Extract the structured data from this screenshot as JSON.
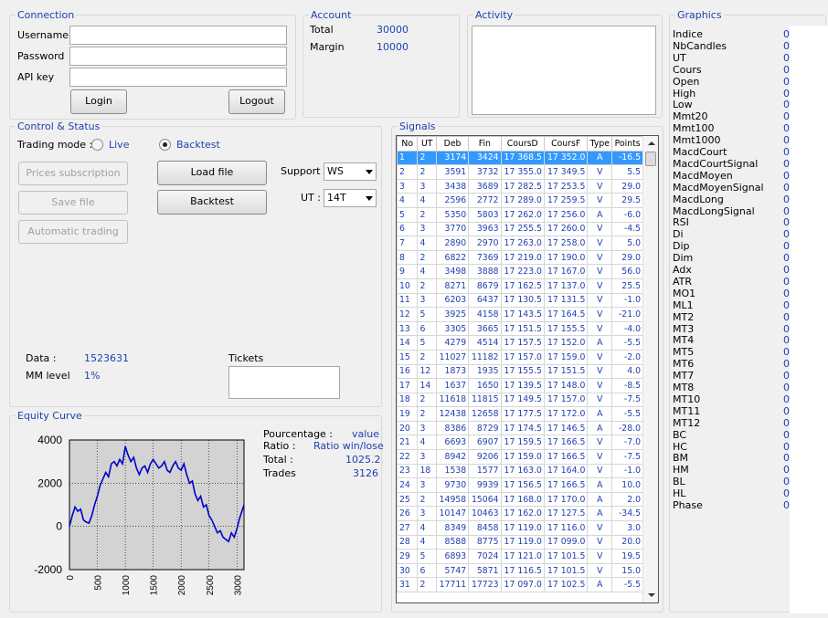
{
  "connection": {
    "title": "Connection",
    "username_label": "Username",
    "password_label": "Password",
    "apikey_label": "API key",
    "login_label": "Login",
    "logout_label": "Logout"
  },
  "account": {
    "title": "Account",
    "total_label": "Total",
    "total_value": "30000",
    "margin_label": "Margin",
    "margin_value": "10000"
  },
  "activity": {
    "title": "Activity"
  },
  "graphics": {
    "title": "Graphics",
    "items": [
      "Indice",
      "NbCandles",
      "UT",
      "Cours",
      "Open",
      "High",
      "Low",
      "Mmt20",
      "Mmt100",
      "Mmt1000",
      "MacdCourt",
      "MacdCourtSignal",
      "MacdMoyen",
      "MacdMoyenSignal",
      "MacdLong",
      "MacdLongSignal",
      "RSI",
      "Di",
      "Dip",
      "Dim",
      "Adx",
      "ATR",
      "MO1",
      "ML1",
      "MT2",
      "MT3",
      "MT4",
      "MT5",
      "MT6",
      "MT7",
      "MT8",
      "MT10",
      "MT11",
      "MT12",
      "BC",
      "HC",
      "BM",
      "HM",
      "BL",
      "HL",
      "Phase"
    ],
    "value": "0"
  },
  "control": {
    "title": "Control & Status",
    "trading_mode_label": "Trading mode :",
    "live_label": "Live",
    "backtest_label": "Backtest",
    "prices_button": "Prices subscription",
    "save_button": "Save file",
    "auto_button": "Automatic trading",
    "load_button": "Load file",
    "backtest_button": "Backtest",
    "support_label": "Support :",
    "support_value": "WS",
    "ut_label": "UT :",
    "ut_value": "14T",
    "data_label": "Data :",
    "data_value": "1523631",
    "mm_label": "MM level",
    "mm_value": "1%",
    "tickets_label": "Tickets"
  },
  "equity": {
    "title": "Equity Curve",
    "pourcentage_label": "Pourcentage :",
    "pourcentage_value": "value",
    "ratio_label": "Ratio :",
    "ratio_value": "Ratio win/lose",
    "total_label": "Total :",
    "total_value": "1025.2",
    "trades_label": "Trades",
    "trades_value": "3126"
  },
  "chart_data": {
    "type": "line",
    "ylim": [
      -2000,
      4000
    ],
    "xlim": [
      0,
      3126
    ],
    "y_ticks": [
      "4000",
      "2000",
      "0",
      "-2000"
    ],
    "x_ticks": [
      "0",
      "500",
      "1000",
      "1500",
      "2000",
      "2500",
      "3000"
    ],
    "grid": true,
    "color": "#0000cc",
    "x": [
      0,
      50,
      100,
      150,
      200,
      250,
      300,
      350,
      400,
      450,
      500,
      550,
      600,
      650,
      700,
      750,
      800,
      850,
      900,
      950,
      1000,
      1050,
      1100,
      1150,
      1200,
      1250,
      1300,
      1350,
      1400,
      1450,
      1500,
      1550,
      1600,
      1650,
      1700,
      1750,
      1800,
      1850,
      1900,
      1950,
      2000,
      2050,
      2100,
      2150,
      2200,
      2250,
      2300,
      2350,
      2400,
      2450,
      2500,
      2550,
      2600,
      2650,
      2700,
      2750,
      2800,
      2850,
      2900,
      2950,
      3000,
      3050,
      3100,
      3126
    ],
    "y": [
      0,
      500,
      900,
      700,
      800,
      300,
      200,
      150,
      500,
      1000,
      1400,
      1900,
      2200,
      2500,
      2300,
      2900,
      3000,
      2800,
      3100,
      2900,
      3700,
      3300,
      3000,
      3200,
      2700,
      2400,
      2700,
      2800,
      2500,
      2900,
      3100,
      2900,
      2700,
      2800,
      3000,
      2600,
      2500,
      2800,
      3000,
      2700,
      2600,
      2900,
      2400,
      2000,
      2100,
      1500,
      1200,
      1400,
      900,
      1000,
      500,
      300,
      0,
      -300,
      -200,
      -500,
      -600,
      -700,
      -300,
      -500,
      -100,
      400,
      800,
      1000
    ]
  },
  "signals": {
    "title": "Signals",
    "columns": [
      "No",
      "UT",
      "Deb",
      "Fin",
      "CoursD",
      "CoursF",
      "Type",
      "Points"
    ],
    "rows": [
      [
        "1",
        "2",
        "3174",
        "3424",
        "17 368.5",
        "17 352.0",
        "A",
        "-16.5"
      ],
      [
        "2",
        "2",
        "3591",
        "3732",
        "17 355.0",
        "17 349.5",
        "V",
        "5.5"
      ],
      [
        "3",
        "3",
        "3438",
        "3689",
        "17 282.5",
        "17 253.5",
        "V",
        "29.0"
      ],
      [
        "4",
        "4",
        "2596",
        "2772",
        "17 289.0",
        "17 259.5",
        "V",
        "29.5"
      ],
      [
        "5",
        "2",
        "5350",
        "5803",
        "17 262.0",
        "17 256.0",
        "A",
        "-6.0"
      ],
      [
        "6",
        "3",
        "3770",
        "3963",
        "17 255.5",
        "17 260.0",
        "V",
        "-4.5"
      ],
      [
        "7",
        "4",
        "2890",
        "2970",
        "17 263.0",
        "17 258.0",
        "V",
        "5.0"
      ],
      [
        "8",
        "2",
        "6822",
        "7369",
        "17 219.0",
        "17 190.0",
        "V",
        "29.0"
      ],
      [
        "9",
        "4",
        "3498",
        "3888",
        "17 223.0",
        "17 167.0",
        "V",
        "56.0"
      ],
      [
        "10",
        "2",
        "8271",
        "8679",
        "17 162.5",
        "17 137.0",
        "V",
        "25.5"
      ],
      [
        "11",
        "3",
        "6203",
        "6437",
        "17 130.5",
        "17 131.5",
        "V",
        "-1.0"
      ],
      [
        "12",
        "5",
        "3925",
        "4158",
        "17 143.5",
        "17 164.5",
        "V",
        "-21.0"
      ],
      [
        "13",
        "6",
        "3305",
        "3665",
        "17 151.5",
        "17 155.5",
        "V",
        "-4.0"
      ],
      [
        "14",
        "5",
        "4279",
        "4514",
        "17 157.5",
        "17 152.0",
        "A",
        "-5.5"
      ],
      [
        "15",
        "2",
        "11027",
        "11182",
        "17 157.0",
        "17 159.0",
        "V",
        "-2.0"
      ],
      [
        "16",
        "12",
        "1873",
        "1935",
        "17 155.5",
        "17 151.5",
        "V",
        "4.0"
      ],
      [
        "17",
        "14",
        "1637",
        "1650",
        "17 139.5",
        "17 148.0",
        "V",
        "-8.5"
      ],
      [
        "18",
        "2",
        "11618",
        "11815",
        "17 149.5",
        "17 157.0",
        "V",
        "-7.5"
      ],
      [
        "19",
        "2",
        "12438",
        "12658",
        "17 177.5",
        "17 172.0",
        "A",
        "-5.5"
      ],
      [
        "20",
        "3",
        "8386",
        "8729",
        "17 174.5",
        "17 146.5",
        "A",
        "-28.0"
      ],
      [
        "21",
        "4",
        "6693",
        "6907",
        "17 159.5",
        "17 166.5",
        "V",
        "-7.0"
      ],
      [
        "22",
        "3",
        "8942",
        "9206",
        "17 159.0",
        "17 166.5",
        "V",
        "-7.5"
      ],
      [
        "23",
        "18",
        "1538",
        "1577",
        "17 163.0",
        "17 164.0",
        "V",
        "-1.0"
      ],
      [
        "24",
        "3",
        "9730",
        "9939",
        "17 156.5",
        "17 166.5",
        "A",
        "10.0"
      ],
      [
        "25",
        "2",
        "14958",
        "15064",
        "17 168.0",
        "17 170.0",
        "A",
        "2.0"
      ],
      [
        "26",
        "3",
        "10147",
        "10463",
        "17 162.0",
        "17 127.5",
        "A",
        "-34.5"
      ],
      [
        "27",
        "4",
        "8349",
        "8458",
        "17 119.0",
        "17 116.0",
        "V",
        "3.0"
      ],
      [
        "28",
        "4",
        "8588",
        "8775",
        "17 119.0",
        "17 099.0",
        "V",
        "20.0"
      ],
      [
        "29",
        "5",
        "6893",
        "7024",
        "17 121.0",
        "17 101.5",
        "V",
        "19.5"
      ],
      [
        "30",
        "6",
        "5747",
        "5871",
        "17 116.5",
        "17 101.5",
        "V",
        "15.0"
      ],
      [
        "31",
        "2",
        "17711",
        "17723",
        "17 097.0",
        "17 102.5",
        "A",
        "-5.5"
      ]
    ]
  }
}
